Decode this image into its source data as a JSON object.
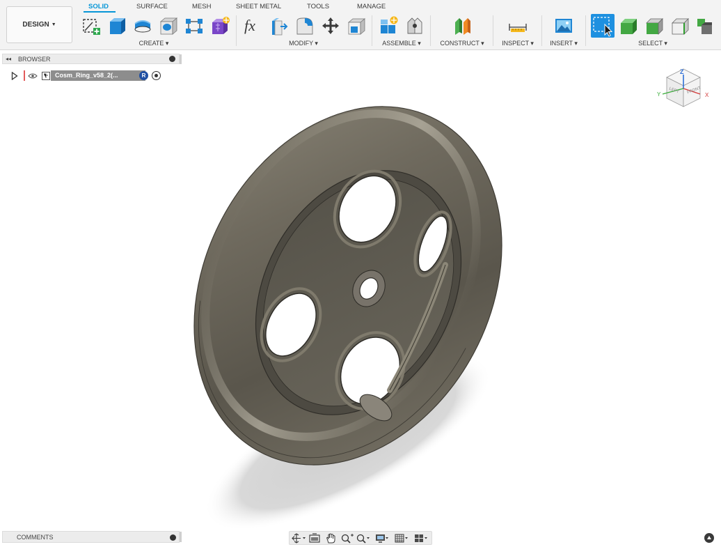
{
  "workspace": {
    "label": "DESIGN"
  },
  "tabs": [
    {
      "label": "SOLID",
      "active": true
    },
    {
      "label": "SURFACE"
    },
    {
      "label": "MESH"
    },
    {
      "label": "SHEET METAL"
    },
    {
      "label": "TOOLS"
    },
    {
      "label": "MANAGE"
    }
  ],
  "groups": {
    "create": "CREATE ▾",
    "modify": "MODIFY ▾",
    "assemble": "ASSEMBLE ▾",
    "construct": "CONSTRUCT ▾",
    "inspect": "INSPECT ▾",
    "insert": "INSERT ▾",
    "select": "SELECT ▾"
  },
  "browser": {
    "title": "BROWSER",
    "component_name": "Cosm_Ring_v58_2(..."
  },
  "comments": {
    "title": "COMMENTS"
  },
  "viewcube": {
    "top": "Z",
    "left": "LEFT",
    "front": "FRONT",
    "x_axis": "X",
    "y_axis": "Y"
  },
  "colors": {
    "accent": "#0696d7",
    "model_base": "#6f6a5f",
    "select_blue": "#1e90e0",
    "green_cube": "#4caf50"
  },
  "icons": {
    "toolbar": [
      "create-sketch-icon",
      "extrude-icon",
      "revolve-icon",
      "hole-icon",
      "pattern-icon",
      "form-icon",
      "parameters-fx-icon",
      "press-pull-icon",
      "fillet-icon",
      "move-icon",
      "appearance-icon",
      "new-component-icon",
      "joint-icon",
      "construct-plane-icon",
      "measure-icon",
      "insert-image-icon",
      "select-window-icon",
      "select-body-icon",
      "select-face-icon",
      "select-edge-icon",
      "select-priority-icon"
    ],
    "navbar": [
      "orbit-icon",
      "look-at-icon",
      "pan-icon",
      "zoom-icon",
      "fit-icon",
      "display-settings-icon",
      "grid-icon",
      "viewports-icon"
    ]
  }
}
